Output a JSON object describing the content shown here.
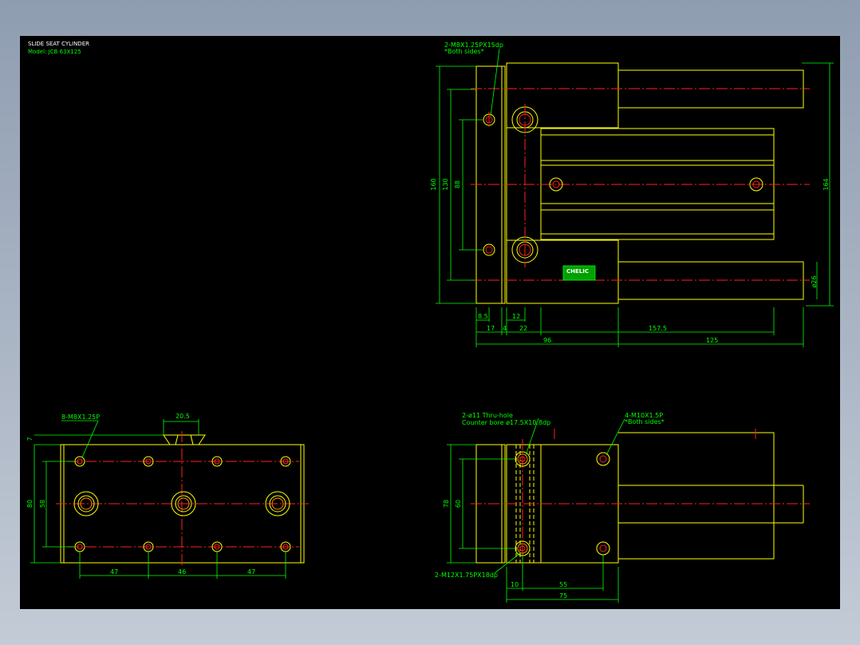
{
  "title_block": {
    "title": "SLIDE SEAT CYLINDER",
    "model": "Model: JCB 63X125"
  },
  "callouts": {
    "top_tap": "2-M8X1.25PX15dp",
    "top_tap_note": "*Both sides*",
    "bottom_tap": "8-M8X1.25P",
    "front_thru": "2-ø11  Thru-hole",
    "front_counter": "Counter bore  ø17.5X10.8dp",
    "front_tap": "4-M10X1.5P",
    "front_tap_note": "*Both sides*",
    "front_lower_tap": "2-M12X1.75PX18dp"
  },
  "label_plate": "CHELIC",
  "dims": {
    "d160": "160",
    "d130": "130",
    "d88": "88",
    "d164": "164",
    "d26": "ø26",
    "d8_5": "8.5",
    "d12": "12",
    "d17": "17",
    "d4": "4",
    "d22": "22",
    "d157_5": "157.5",
    "d96": "96",
    "d125": "125",
    "d20_5": "20.5",
    "d7": "7",
    "d80": "80",
    "d58": "58",
    "d47a": "47",
    "d46": "46",
    "d47b": "47",
    "d78": "78",
    "d60": "60",
    "d10": "10",
    "d55": "55",
    "d75": "75"
  }
}
